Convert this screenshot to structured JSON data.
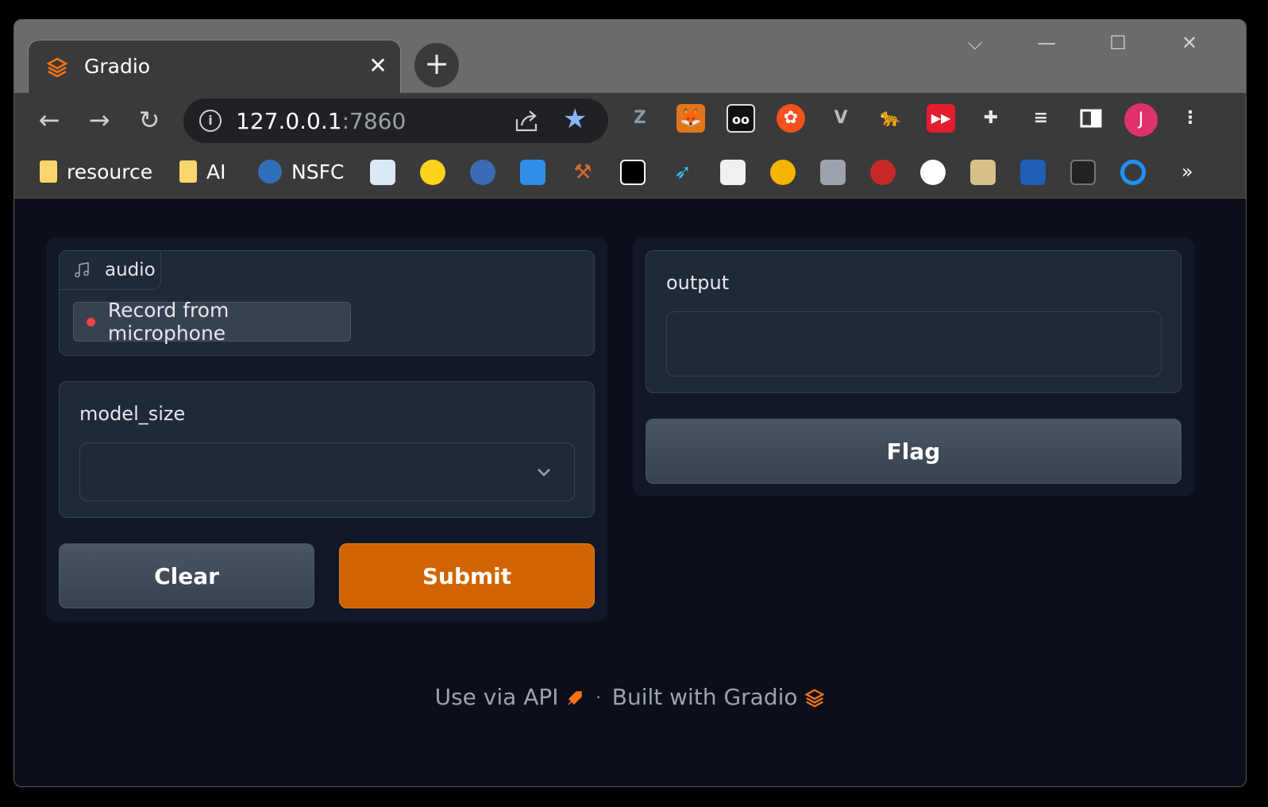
{
  "browser": {
    "tab_title": "Gradio",
    "tab_close": "✕",
    "new_tab": "+",
    "url_host": "127.0.0.1",
    "url_port": ":7860",
    "avatar_initial": "J",
    "window_controls": {
      "dropdown": "⌵",
      "minimize": "—",
      "maximize": "☐",
      "close": "✕"
    }
  },
  "bookmarks": [
    {
      "label": "resource"
    },
    {
      "label": "AI"
    },
    {
      "label": "NSFC"
    }
  ],
  "bookmarks_overflow": "»",
  "app": {
    "audio": {
      "tab_label": "audio",
      "record_label": "Record from microphone"
    },
    "model_size": {
      "label": "model_size",
      "value": ""
    },
    "buttons": {
      "clear": "Clear",
      "submit": "Submit",
      "flag": "Flag"
    },
    "output": {
      "label": "output",
      "value": ""
    },
    "footer": {
      "api_link": "Use via API",
      "separator": "·",
      "built_with": "Built with Gradio"
    }
  },
  "colors": {
    "accent": "#d16400",
    "background": "#0b0f19",
    "panel": "#111827",
    "block": "#1f2937"
  }
}
